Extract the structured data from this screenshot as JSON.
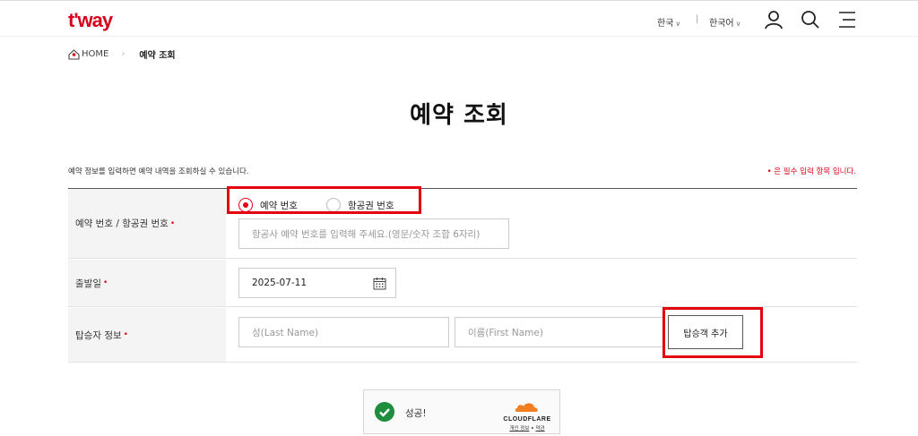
{
  "header": {
    "logo": "t'way",
    "lang_country": "한국",
    "lang_separator": "|",
    "lang_language": "한국어",
    "icons": [
      "user-icon",
      "search-icon",
      "menu-icon"
    ]
  },
  "breadcrumb": {
    "home": "HOME",
    "separator": "›",
    "current": "예약 조회"
  },
  "page": {
    "title": "예약 조회",
    "intro": "예약 정보를 입력하면 예약 내역을 조회하실 수 있습니다.",
    "required_note": "• 은 필수 입력 항목 입니다."
  },
  "form": {
    "booking": {
      "label": "예약 번호 / 항공권 번호",
      "required": "•",
      "options": [
        "예약 번호",
        "항공권 번호"
      ],
      "selected": "예약 번호",
      "placeholder": "항공사 예약 번호를 입력해 주세요.(영문/숫자 조합 6자리)",
      "value": ""
    },
    "departure": {
      "label": "출발일",
      "required": "•",
      "value": "2025-07-11"
    },
    "passenger": {
      "label": "탑승자 정보",
      "required": "•",
      "last_name_placeholder": "성(Last Name)",
      "first_name_placeholder": "이름(First Name)",
      "add_button": "탑승객 추가"
    }
  },
  "captcha": {
    "status": "성공!",
    "brand": "CLOUDFLARE",
    "privacy_link": "개인 정보",
    "link_separator": "•",
    "terms_link": "약관"
  },
  "colors": {
    "brand_red": "#d6001c",
    "highlight_box": "#e4000f",
    "success_green": "#1e8e3e"
  }
}
